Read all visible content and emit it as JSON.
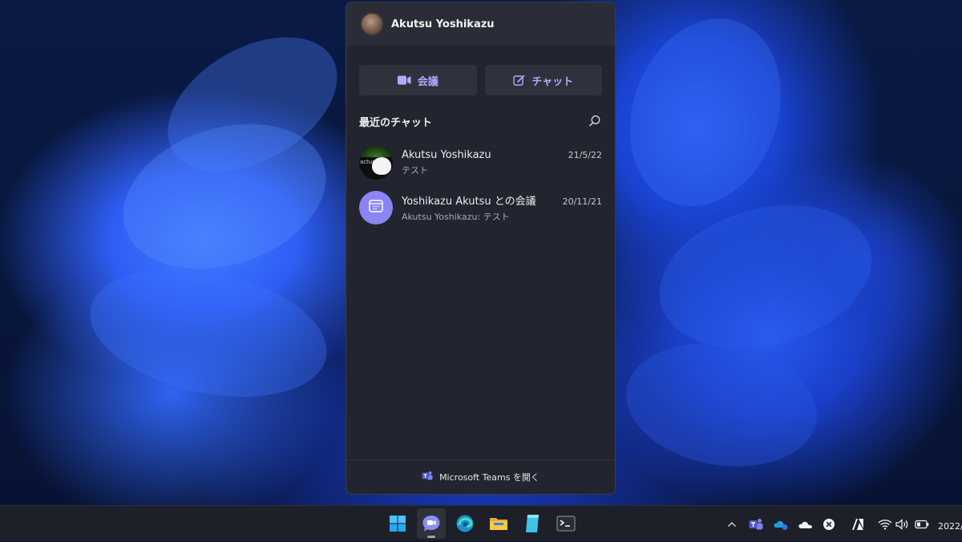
{
  "flyout": {
    "user_name": "Akutsu Yoshikazu",
    "meet_label": "会議",
    "chat_label": "チャット",
    "recent_title": "最近のチャット",
    "chats": [
      {
        "name": "Akutsu Yoshikazu",
        "date": "21/5/22",
        "preview": "テスト",
        "avatar_tag": "actus"
      },
      {
        "name": "Yoshikazu Akutsu との会議",
        "date": "20/11/21",
        "preview": "Akutsu Yoshikazu: テスト"
      }
    ],
    "footer_label": "Microsoft Teams を開く"
  },
  "taskbar": {
    "apps": [
      "windows-start-icon",
      "teams-chat-icon",
      "edge-icon",
      "file-explorer-icon",
      "notepad-icon",
      "terminal-icon"
    ],
    "tray_icons": [
      "chevron-up-icon",
      "teams-tray-icon",
      "onedrive-sync-icon",
      "onedrive-icon",
      "close-circle-icon",
      "adobe-icon",
      "wifi-icon",
      "volume-icon",
      "battery-icon"
    ],
    "date": "2022/"
  },
  "colors": {
    "accent": "#b7a8ff",
    "panel": "#22252f",
    "taskbar": "#1d2029"
  }
}
